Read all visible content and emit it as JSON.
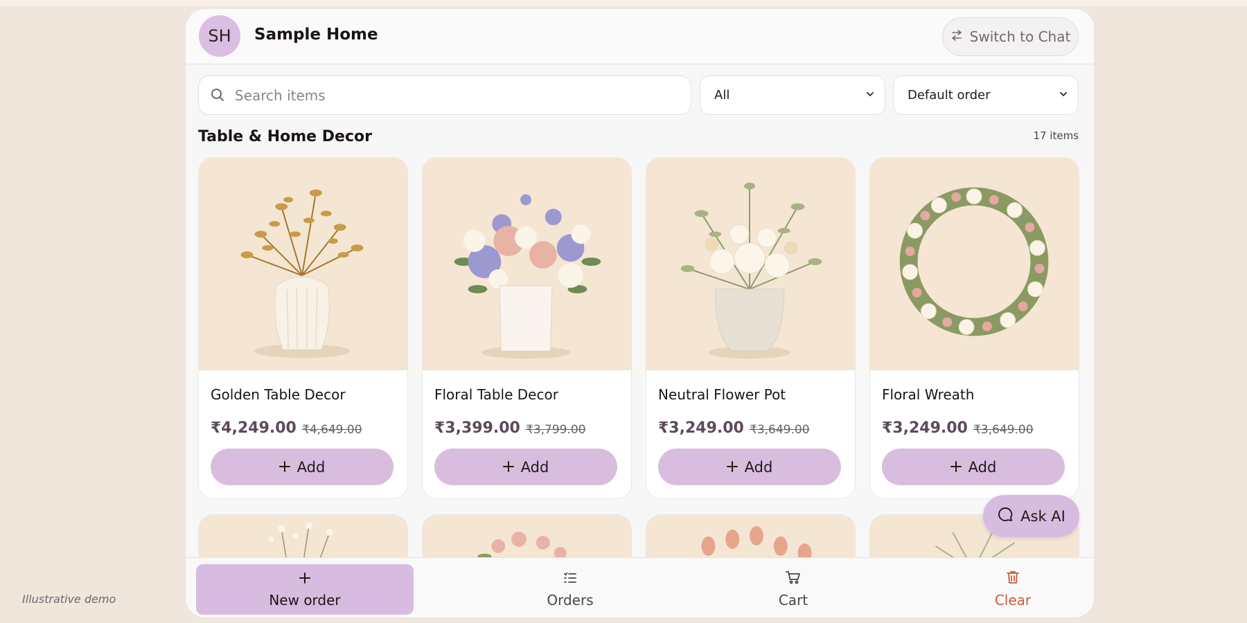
{
  "watermark": "Illustrative demo",
  "header": {
    "avatar_initials": "SH",
    "store_name": "Sample Home",
    "switch_label": "Switch to Chat",
    "switch_icon": "swap-arrows-icon"
  },
  "search": {
    "placeholder": "Search items",
    "icon": "search-icon"
  },
  "filters": {
    "category": {
      "selected": "All"
    },
    "sort": {
      "selected": "Default order"
    }
  },
  "section": {
    "title": "Table & Home Decor",
    "count": "17 items"
  },
  "products": [
    {
      "name": "Golden Table Decor",
      "price": "₹4,249.00",
      "mrp": "₹4,649.00",
      "add_label": "Add"
    },
    {
      "name": "Floral Table Decor",
      "price": "₹3,399.00",
      "mrp": "₹3,799.00",
      "add_label": "Add"
    },
    {
      "name": "Neutral Flower Pot",
      "price": "₹3,249.00",
      "mrp": "₹3,649.00",
      "add_label": "Add"
    },
    {
      "name": "Floral Wreath",
      "price": "₹3,249.00",
      "mrp": "₹3,649.00",
      "add_label": "Add"
    }
  ],
  "ask_ai": {
    "label": "Ask AI",
    "icon": "chat-bubble-icon"
  },
  "bottom_nav": {
    "new_order": {
      "label": "New order",
      "icon": "plus-icon"
    },
    "orders": {
      "label": "Orders",
      "icon": "list-icon"
    },
    "cart": {
      "label": "Cart",
      "icon": "cart-icon"
    },
    "clear": {
      "label": "Clear",
      "icon": "trash-icon"
    }
  },
  "colors": {
    "accent": "#d9bddf",
    "background": "#efe6dc",
    "clear_text": "#c65c3a",
    "price_text": "#5c4a5b"
  }
}
